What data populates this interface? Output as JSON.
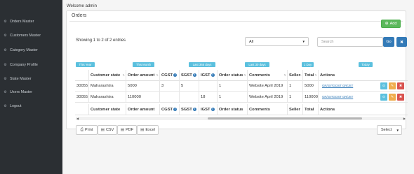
{
  "sidebar": {
    "items": [
      {
        "label": "Orders Master",
        "icon": "gear-icon"
      },
      {
        "label": "Customers Master",
        "icon": "gear-icon"
      },
      {
        "label": "Category Master",
        "icon": "gear-icon"
      },
      {
        "label": "Company Profile",
        "icon": "gear-icon"
      },
      {
        "label": "State Master",
        "icon": "gear-icon"
      },
      {
        "label": "Users Master",
        "icon": "gear-icon"
      },
      {
        "label": "Logout",
        "icon": "gear-icon"
      }
    ]
  },
  "header": {
    "welcome": "Welcome admin"
  },
  "panel": {
    "title": "Orders",
    "add_label": "Add"
  },
  "toolbar": {
    "entries_info": "Showing 1 to 2 of 2 entries",
    "filter_select": "All",
    "search_placeholder": "Search",
    "go_label": "Go",
    "clear_label": "✖"
  },
  "date_filters": {
    "this_year": "This Year",
    "this_month": "This Month",
    "last_365": "Last 365 days",
    "last_30": "Last 30 days",
    "one_day": "1 Day",
    "today": "Today"
  },
  "table": {
    "columns": [
      "",
      "Customer state",
      "Order amount",
      "CGST",
      "SGST",
      "IGST",
      "Order status",
      "Comments",
      "Seller",
      "Total",
      "Actions"
    ],
    "rows": [
      {
        "id": "30055",
        "state": "Maharashtra",
        "amount": "5000",
        "cgst": "3",
        "sgst": "5",
        "igst": "",
        "status": "1",
        "comments": "Website April 2019",
        "seller": "1",
        "total": "5000",
        "links": "GR/JSTGOST      GR/JST"
      },
      {
        "id": "30055",
        "state": "Maharashtra",
        "amount": "110000",
        "cgst": "",
        "sgst": "",
        "igst": "18",
        "status": "1",
        "comments": "Website April 2019",
        "seller": "1",
        "total": "110000",
        "links": "GR/JSTGOST      GR/JST"
      }
    ]
  },
  "export": {
    "print": "Print",
    "csv": "CSV",
    "pdf": "PDF",
    "excel": "Excel"
  },
  "page_length": {
    "selected": "Select"
  },
  "colors": {
    "sidebar_bg": "#2b2f33",
    "primary": "#337ab7",
    "success": "#5cb85c",
    "info": "#5bc0de",
    "warning": "#f0ad4e",
    "danger": "#d9534f"
  }
}
